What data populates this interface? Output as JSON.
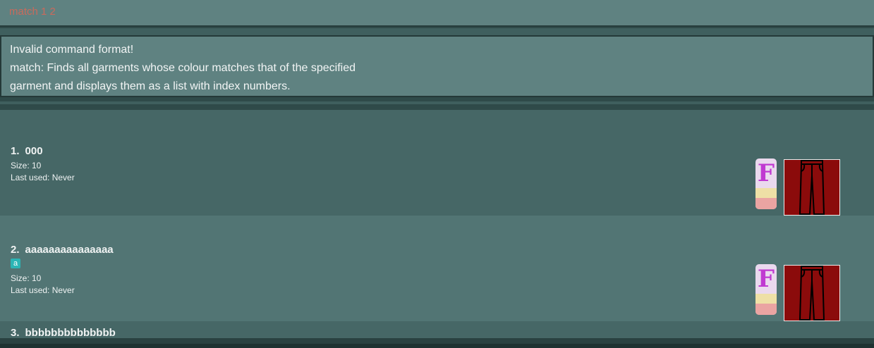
{
  "command_box": {
    "text": "match 1 2"
  },
  "result_box": {
    "lines": [
      "Invalid command format!",
      "match: Finds all garments whose colour matches that of the specified",
      "garment and displays them as a list with index numbers."
    ]
  },
  "garments": [
    {
      "index": "1.",
      "name": "000",
      "tags": [],
      "size": "Size: 10",
      "last_used": "Last used: Never",
      "formality_letter": "F",
      "colour": "#8b0b0b",
      "type_icon": "pants-icon"
    },
    {
      "index": "2.",
      "name": "aaaaaaaaaaaaaaa",
      "tags": [
        "a"
      ],
      "size": "Size: 10",
      "last_used": "Last used: Never",
      "formality_letter": "F",
      "colour": "#8b0b0b",
      "type_icon": "pants-icon"
    },
    {
      "index": "3.",
      "name": "bbbbbbbbbbbbbb"
    }
  ]
}
